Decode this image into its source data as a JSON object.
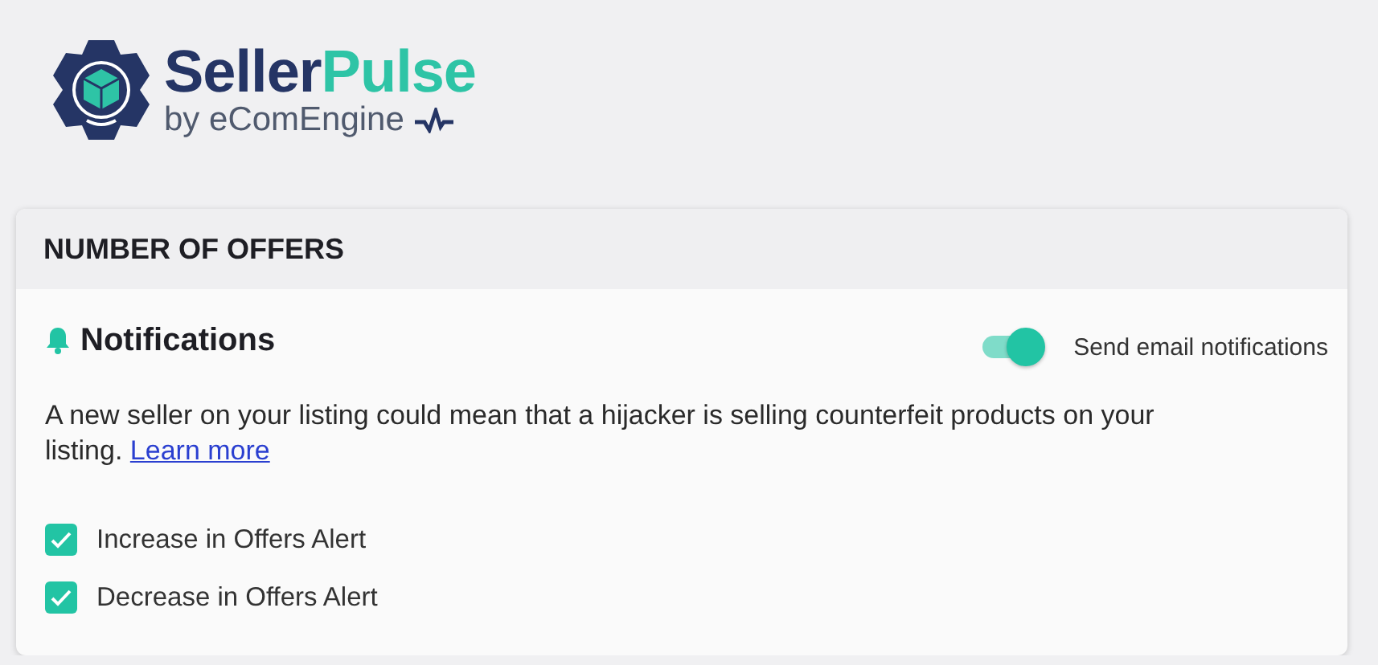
{
  "brand": {
    "name_first": "Seller",
    "name_second": "Pulse",
    "tagline": "by eComEngine"
  },
  "card": {
    "title": "NUMBER OF OFFERS",
    "notifications": {
      "heading": "Notifications",
      "toggle": {
        "label": "Send email notifications",
        "on": true
      },
      "description": "A new seller on your listing could mean that a hijacker is selling counterfeit products on your listing.",
      "link": "Learn more"
    },
    "alerts": [
      {
        "label": "Increase in Offers Alert",
        "checked": true
      },
      {
        "label": "Decrease in Offers Alert",
        "checked": true
      }
    ]
  }
}
